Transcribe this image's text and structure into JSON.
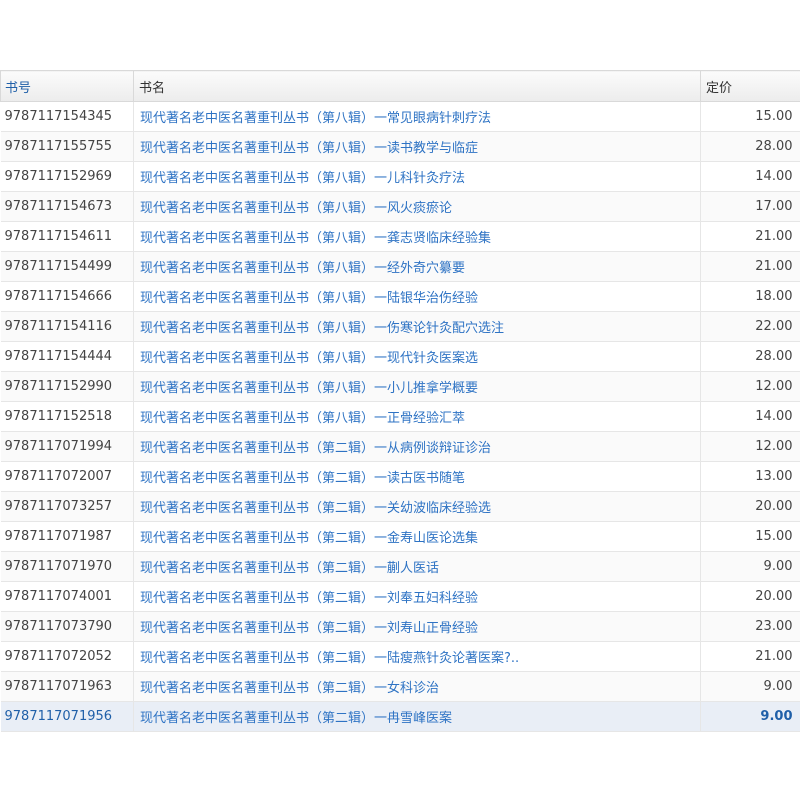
{
  "table": {
    "headers": {
      "isbn": "书号",
      "title": "书名",
      "price": "定价"
    },
    "rows": [
      {
        "isbn": "9787117154345",
        "title": "现代著名老中医名著重刊丛书（第八辑）一常见眼病针刺疗法",
        "price": "15.00"
      },
      {
        "isbn": "9787117155755",
        "title": "现代著名老中医名著重刊丛书（第八辑）一读书教学与临症",
        "price": "28.00"
      },
      {
        "isbn": "9787117152969",
        "title": "现代著名老中医名著重刊丛书（第八辑）一儿科针灸疗法",
        "price": "14.00"
      },
      {
        "isbn": "9787117154673",
        "title": "现代著名老中医名著重刊丛书（第八辑）一风火痰瘀论",
        "price": "17.00"
      },
      {
        "isbn": "9787117154611",
        "title": "现代著名老中医名著重刊丛书（第八辑）一龚志贤临床经验集",
        "price": "21.00"
      },
      {
        "isbn": "9787117154499",
        "title": "现代著名老中医名著重刊丛书（第八辑）一经外奇穴纂要",
        "price": "21.00"
      },
      {
        "isbn": "9787117154666",
        "title": "现代著名老中医名著重刊丛书（第八辑）一陆银华治伤经验",
        "price": "18.00"
      },
      {
        "isbn": "9787117154116",
        "title": "现代著名老中医名著重刊丛书（第八辑）一伤寒论针灸配穴选注",
        "price": "22.00"
      },
      {
        "isbn": "9787117154444",
        "title": "现代著名老中医名著重刊丛书（第八辑）一现代针灸医案选",
        "price": "28.00"
      },
      {
        "isbn": "9787117152990",
        "title": "现代著名老中医名著重刊丛书（第八辑）一小儿推拿学概要",
        "price": "12.00"
      },
      {
        "isbn": "9787117152518",
        "title": "现代著名老中医名著重刊丛书（第八辑）一正骨经验汇萃",
        "price": "14.00"
      },
      {
        "isbn": "9787117071994",
        "title": "现代著名老中医名著重刊丛书（第二辑）一从病例谈辩证诊治",
        "price": "12.00"
      },
      {
        "isbn": "9787117072007",
        "title": "现代著名老中医名著重刊丛书（第二辑）一读古医书随笔",
        "price": "13.00"
      },
      {
        "isbn": "9787117073257",
        "title": "现代著名老中医名著重刊丛书（第二辑）一关幼波临床经验选",
        "price": "20.00"
      },
      {
        "isbn": "9787117071987",
        "title": "现代著名老中医名著重刊丛书（第二辑）一金寿山医论选集",
        "price": "15.00"
      },
      {
        "isbn": "9787117071970",
        "title": "现代著名老中医名著重刊丛书（第二辑）一蒯人医话",
        "price": "9.00"
      },
      {
        "isbn": "9787117074001",
        "title": "现代著名老中医名著重刊丛书（第二辑）一刘奉五妇科经验",
        "price": "20.00"
      },
      {
        "isbn": "9787117073790",
        "title": "现代著名老中医名著重刊丛书（第二辑）一刘寿山正骨经验",
        "price": "23.00"
      },
      {
        "isbn": "9787117072052",
        "title": "现代著名老中医名著重刊丛书（第二辑）一陆瘦燕针灸论著医案?..",
        "price": "21.00"
      },
      {
        "isbn": "9787117071963",
        "title": "现代著名老中医名著重刊丛书（第二辑）一女科诊治",
        "price": "9.00"
      },
      {
        "isbn": "9787117071956",
        "title": "现代著名老中医名著重刊丛书（第二辑）一冉雪峰医案",
        "price": "9.00"
      }
    ]
  }
}
